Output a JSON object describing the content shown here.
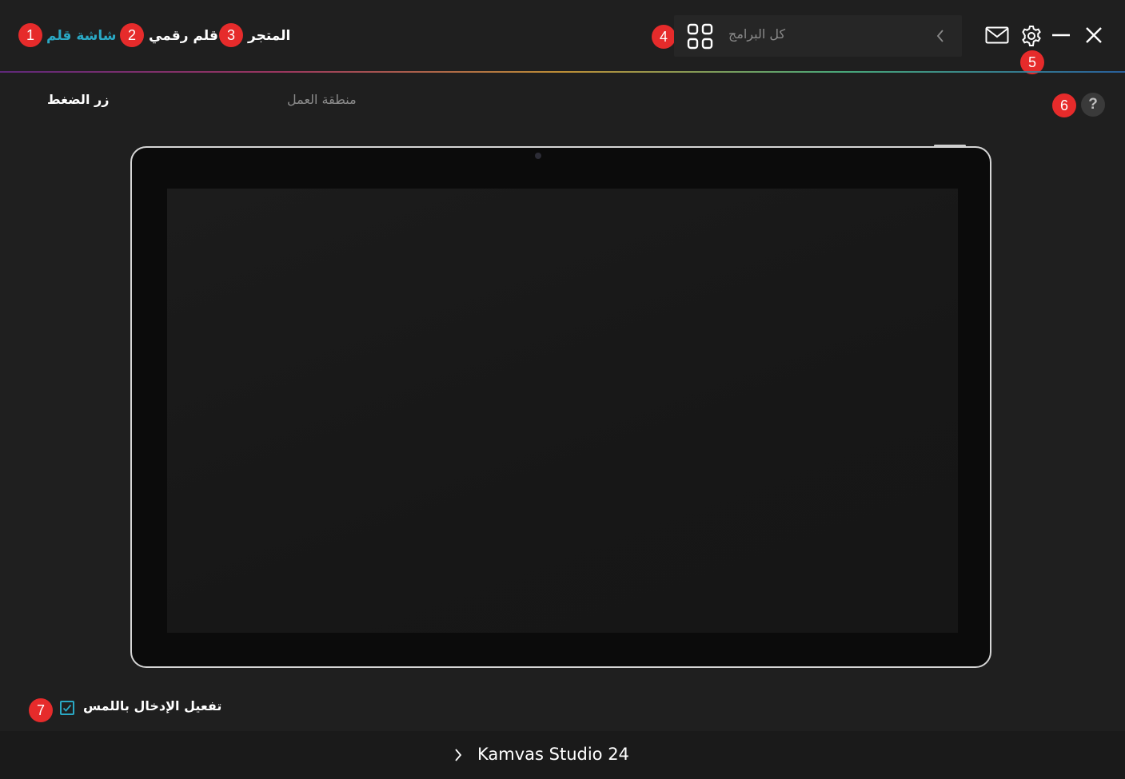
{
  "nav": {
    "tabs": [
      {
        "label": "شاشة قلم",
        "active": true
      },
      {
        "label": "قلم رقمي"
      },
      {
        "label": "المتجر"
      }
    ],
    "badges": [
      "1",
      "2",
      "3"
    ]
  },
  "search": {
    "placeholder": "كل البرامج",
    "badge": "4"
  },
  "window_controls": {
    "settings_badge": "5"
  },
  "subtabs": [
    {
      "label": "زر الضغط",
      "active": true
    },
    {
      "label": "منطقة العمل"
    }
  ],
  "help": {
    "label": "?",
    "badge": "6"
  },
  "touch": {
    "label": "تفعيل الإدخال باللمس",
    "checked": true,
    "badge": "7"
  },
  "footer": {
    "device_name": "Kamvas Studio 24"
  },
  "colors": {
    "accent": "#2aa8c4",
    "badge": "#e62b2b",
    "background": "#1f1f1f"
  }
}
